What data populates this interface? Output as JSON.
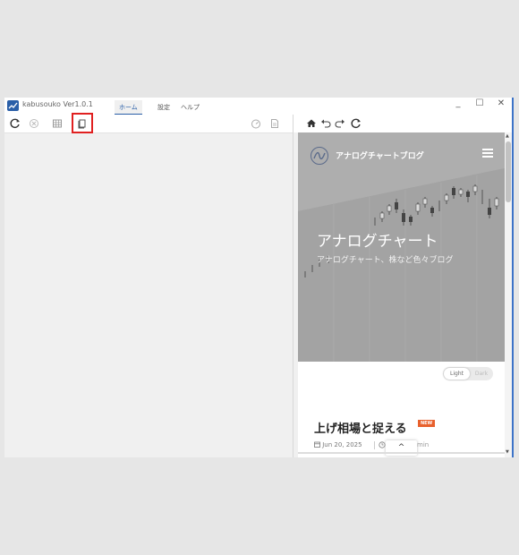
{
  "app": {
    "title": "kabusouko Ver1.0.1",
    "menu": [
      "ホーム",
      "設定",
      "ヘルプ"
    ],
    "window_controls": {
      "minimize": "_",
      "maximize": "☐",
      "close": "✕"
    }
  },
  "left_toolbar": {
    "icons": [
      "refresh-icon",
      "stop-icon",
      "grid-icon",
      "copy-icon"
    ],
    "right_icons": [
      "timer-icon",
      "document-icon"
    ]
  },
  "right_toolbar": {
    "icons": [
      "home-icon",
      "undo-icon",
      "redo-icon",
      "reload-icon"
    ]
  },
  "browser": {
    "site_name": "アナログチャートブログ",
    "hero_title": "アナログチャート",
    "hero_subtitle": "アナログチャート、株など色々ブログ",
    "theme_toggle": {
      "light": "Light",
      "dark": "Dark"
    },
    "post": {
      "title": "上げ相場と捉える",
      "badge": "NEW",
      "date": "Jun 20, 2025",
      "read_time": "min"
    },
    "back_to_top": "^"
  },
  "colors": {
    "accent": "#2a5fa8",
    "highlight_box": "#e02020",
    "badge": "#e8602c",
    "hero_bg": "#a2a2a2"
  }
}
